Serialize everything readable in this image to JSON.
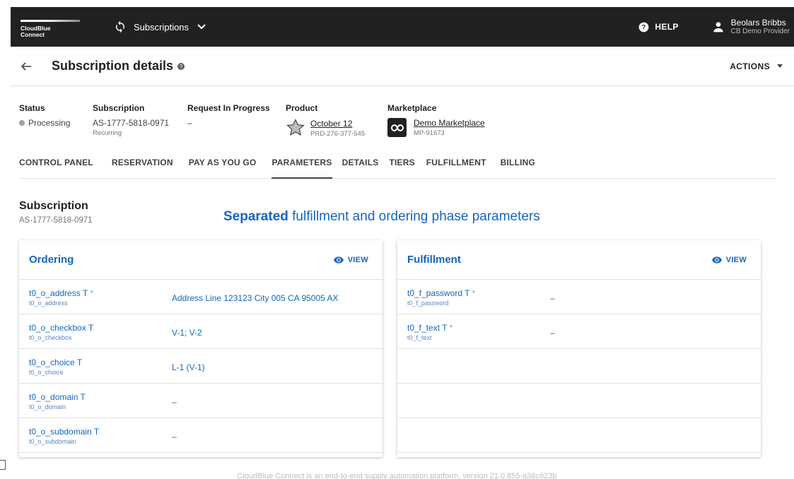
{
  "topbar": {
    "logo_text": "CloudBlue Connect",
    "module": "Subscriptions",
    "help_label": "HELP",
    "user_name": "Beolars Bribbs",
    "user_org": "CB Demo Provider"
  },
  "header": {
    "title": "Subscription details",
    "actions_label": "ACTIONS"
  },
  "fields": {
    "status_label": "Status",
    "status_value": "Processing",
    "subscription_label": "Subscription",
    "subscription_id": "AS-1777-5818-0971",
    "subscription_type": "Recurring",
    "request_label": "Request In Progress",
    "request_value": "–",
    "product_label": "Product",
    "product_name": "October 12",
    "product_id": "PRD-276-377-545",
    "marketplace_label": "Marketplace",
    "marketplace_name": "Demo Marketplace",
    "marketplace_id": "MP-91673"
  },
  "tabs": [
    "CONTROL PANEL",
    "RESERVATION",
    "PAY AS YOU GO",
    "PARAMETERS",
    "DETAILS",
    "TIERS",
    "FULFILLMENT",
    "BILLING"
  ],
  "active_tab": "PARAMETERS",
  "section": {
    "title": "Subscription",
    "id": "AS-1777-5818-0971"
  },
  "banner": {
    "bold": "Separated",
    "rest": "fulfillment and ordering phase parameters"
  },
  "ordering": {
    "title": "Ordering",
    "view_label": "VIEW",
    "rows": [
      {
        "name": "t0_o_address T",
        "required": "*",
        "id": "t0_o_address",
        "value": "Address Line 123123 City 005 CA 95005 AX"
      },
      {
        "name": "t0_o_checkbox T",
        "required": "",
        "id": "t0_o_checkbox",
        "value": "V-1; V-2"
      },
      {
        "name": "t0_o_choice T",
        "required": "",
        "id": "t0_o_choice",
        "value": "L-1 (V-1)"
      },
      {
        "name": "t0_o_domain T",
        "required": "",
        "id": "t0_o_domain",
        "value": "–"
      },
      {
        "name": "t0_o_subdomain T",
        "required": "",
        "id": "t0_o_subdomain",
        "value": "–"
      }
    ]
  },
  "fulfillment": {
    "title": "Fulfillment",
    "view_label": "VIEW",
    "rows": [
      {
        "name": "t0_f_password T",
        "required": "*",
        "id": "t0_f_password",
        "value": "–"
      },
      {
        "name": "t0_f_text T",
        "required": "*",
        "id": "t0_f_text",
        "value": "–"
      }
    ]
  },
  "footer": "CloudBlue Connect is an end-to-end supply automation platform, version 21.0.855-g38c923b",
  "colors": {
    "topbar": "#212121",
    "accent": "#1565c0",
    "status_dot": "#9e9e9e"
  }
}
